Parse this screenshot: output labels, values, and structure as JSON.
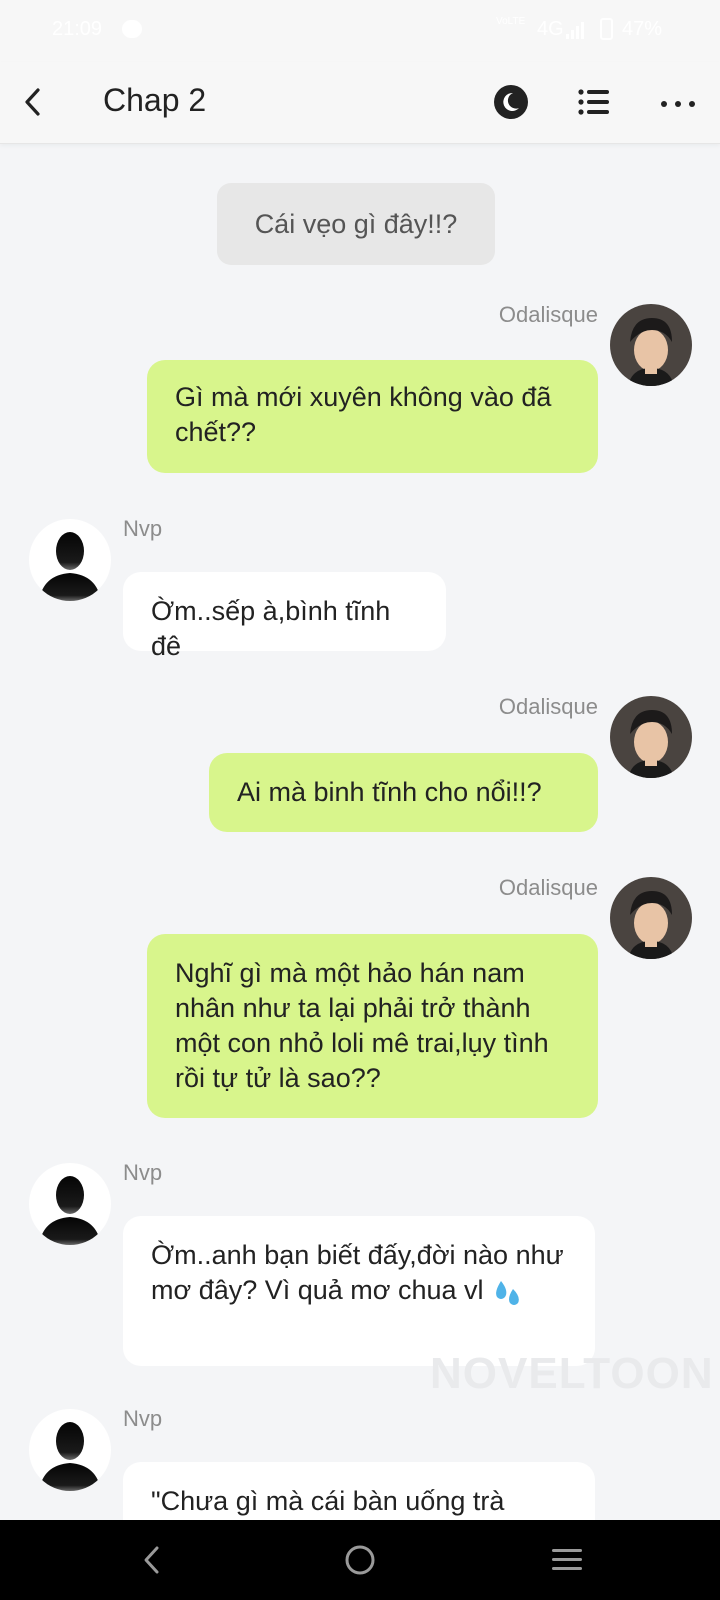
{
  "status_bar": {
    "time": "21:09",
    "network_vo": "VoLTE",
    "network_type": "4G",
    "battery": "47%"
  },
  "header": {
    "title": "Chap 2",
    "back_icon": "chevron-left-icon",
    "night_icon": "night-mode-icon",
    "list_icon": "list-icon",
    "more_icon": "more-icon"
  },
  "chat": {
    "narration": "Cái vẹo gì đây!!?",
    "messages": [
      {
        "sender": "Odalisque",
        "side": "right",
        "text": "Gì mà mới xuyên không vào đã chết??"
      },
      {
        "sender": "Nvp",
        "side": "left",
        "text": "Ờm..sếp à,bình tĩnh đê"
      },
      {
        "sender": "Odalisque",
        "side": "right",
        "text": "Ai mà binh tĩnh cho nổi!!?"
      },
      {
        "sender": "Odalisque",
        "side": "right",
        "text": "Nghĩ gì mà một hảo hán nam nhân như ta lại phải trở thành một con nhỏ loli mê trai,lụy tình rồi tự tử là sao??"
      },
      {
        "sender": "Nvp",
        "side": "left",
        "text": "Ờm..anh bạn biết đấy,đời nào như mơ đây? Vì quả mơ chua vl"
      },
      {
        "sender": "Nvp",
        "side": "left",
        "text": "\"Chưa gì mà cái bàn uống trà"
      }
    ]
  },
  "watermark": "NOVELTOON",
  "colors": {
    "my_bubble": "#d8f58c",
    "other_bubble": "#ffffff",
    "background": "#f4f5f7"
  }
}
